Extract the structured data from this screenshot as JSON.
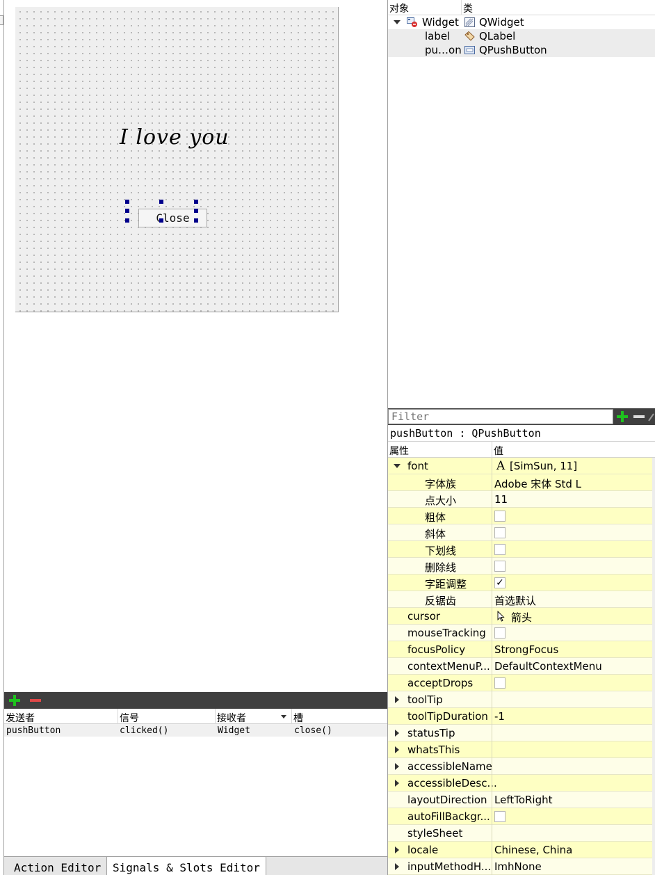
{
  "form": {
    "label_text": "I love you",
    "button_text": "Close"
  },
  "object_inspector": {
    "col_object": "对象",
    "col_class": "类",
    "rows": [
      {
        "name": "Widget",
        "class": "QWidget"
      },
      {
        "name": "label",
        "class": "QLabel"
      },
      {
        "name": "pu…on",
        "class": "QPushButton"
      }
    ]
  },
  "filter": {
    "placeholder": "Filter"
  },
  "property_editor": {
    "selected_title": "pushButton : QPushButton",
    "col_property": "属性",
    "col_value": "值",
    "rows": [
      {
        "name": "font",
        "value": "[SimSun, 11]",
        "icon": "font-icon"
      },
      {
        "name": "字体族",
        "value": "Adobe 宋体 Std L"
      },
      {
        "name": "点大小",
        "value": "11"
      },
      {
        "name": "粗体",
        "checked": false
      },
      {
        "name": "斜体",
        "checked": false
      },
      {
        "name": "下划线",
        "checked": false
      },
      {
        "name": "删除线",
        "checked": false
      },
      {
        "name": "字距调整",
        "checked": true
      },
      {
        "name": "反锯齿",
        "value": "首选默认"
      },
      {
        "name": "cursor",
        "value": "箭头",
        "icon": "arrow-cursor-icon"
      },
      {
        "name": "mouseTracking",
        "checked": false
      },
      {
        "name": "focusPolicy",
        "value": "StrongFocus"
      },
      {
        "name": "contextMenuP...",
        "value": "DefaultContextMenu"
      },
      {
        "name": "acceptDrops",
        "checked": false
      },
      {
        "name": "toolTip",
        "value": ""
      },
      {
        "name": "toolTipDuration",
        "value": "-1"
      },
      {
        "name": "statusTip",
        "value": ""
      },
      {
        "name": "whatsThis",
        "value": ""
      },
      {
        "name": "accessibleName",
        "value": ""
      },
      {
        "name": "accessibleDesc...",
        "value": ""
      },
      {
        "name": "layoutDirection",
        "value": "LeftToRight"
      },
      {
        "name": "autoFillBackgr...",
        "checked": false
      },
      {
        "name": "styleSheet",
        "value": ""
      },
      {
        "name": "locale",
        "value": "Chinese, China"
      },
      {
        "name": "inputMethodH...",
        "value": "ImhNone"
      }
    ]
  },
  "signals_slots": {
    "col_sender": "发送者",
    "col_signal": "信号",
    "col_receiver": "接收者",
    "col_slot": "槽",
    "rows": [
      {
        "sender": "pushButton",
        "signal": "clicked()",
        "receiver": "Widget",
        "slot": "close()"
      }
    ]
  },
  "tabs": {
    "action_editor": "Action Editor",
    "signals_slots_editor": "Signals & Slots Editor"
  },
  "colors": {
    "selection_handle": "#00008b",
    "property_row_dark": "#feffc3",
    "property_row_light": "#fefee8",
    "toolbar_bg": "#3f3f3f",
    "add_green": "#1ec21e",
    "remove_red": "#e04848"
  }
}
